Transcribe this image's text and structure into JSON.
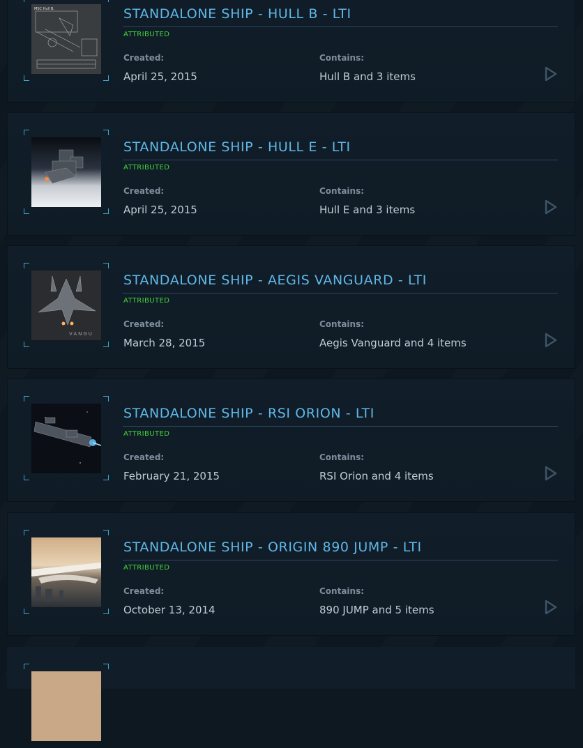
{
  "pledges": [
    {
      "title": "STANDALONE SHIP - HULL B - LTI",
      "badge": "ATTRIBUTED",
      "created_label": "Created:",
      "created": "April 25, 2015",
      "contains_label": "Contains:",
      "contains": "Hull B and 3 items",
      "image": "hull-b-blueprint"
    },
    {
      "title": "STANDALONE SHIP - HULL E - LTI",
      "badge": "ATTRIBUTED",
      "created_label": "Created:",
      "created": "April 25, 2015",
      "contains_label": "Contains:",
      "contains": "Hull E and 3 items",
      "image": "hull-e-render"
    },
    {
      "title": "STANDALONE SHIP - AEGIS VANGUARD - LTI",
      "badge": "ATTRIBUTED",
      "created_label": "Created:",
      "created": "March 28, 2015",
      "contains_label": "Contains:",
      "contains": "Aegis Vanguard and 4 items",
      "image": "aegis-vanguard-render",
      "image_caption": "VANGU"
    },
    {
      "title": "STANDALONE SHIP - RSI ORION - LTI",
      "badge": "ATTRIBUTED",
      "created_label": "Created:",
      "created": "February 21, 2015",
      "contains_label": "Contains:",
      "contains": "RSI Orion and 4 items",
      "image": "rsi-orion-render"
    },
    {
      "title": "STANDALONE SHIP - ORIGIN 890 JUMP - LTI",
      "badge": "ATTRIBUTED",
      "created_label": "Created:",
      "created": "October 13, 2014",
      "contains_label": "Contains:",
      "contains": "890 JUMP and 5 items",
      "image": "origin-890-jump-render"
    }
  ],
  "colors": {
    "title": "#5fb8e8",
    "badge": "#43d43a",
    "frame": "#3aa7c8",
    "arrow": "#3e5566"
  },
  "icons": {
    "expand": "play-arrow-icon"
  }
}
